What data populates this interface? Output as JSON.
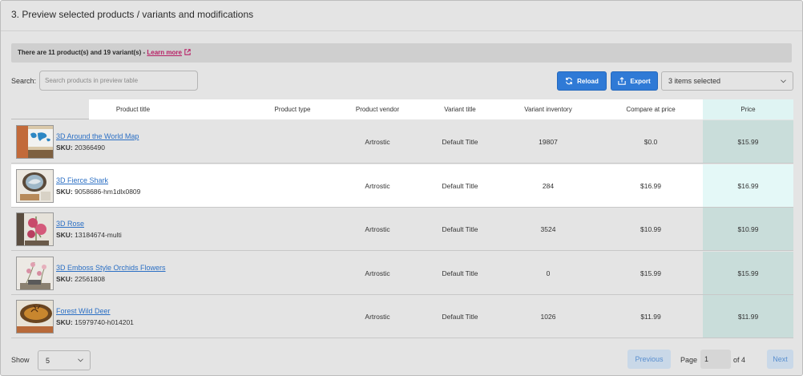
{
  "section_title": "3. Preview selected products / variants and modifications",
  "notice": {
    "text": "There are 11 product(s) and 19 variant(s) - ",
    "link": "Learn more"
  },
  "search": {
    "label": "Search:",
    "placeholder": "Search products in preview table"
  },
  "toolbar": {
    "reload_label": "Reload",
    "export_label": "Export",
    "selected_label": "3 items selected"
  },
  "table": {
    "headers": [
      "Product title",
      "Product type",
      "Product vendor",
      "Variant title",
      "Variant inventory",
      "Compare at price",
      "Price"
    ],
    "rows": [
      {
        "title": "3D Around the World Map",
        "sku_label": "SKU:",
        "sku": "20366490",
        "type": "",
        "vendor": "Artrostic",
        "variant": "Default Title",
        "inventory": "19807",
        "compare": "$0.0",
        "price": "$15.99",
        "thumb": "world-map"
      },
      {
        "title": "3D Fierce Shark",
        "sku_label": "SKU:",
        "sku": "9058686-hm1dlx0809",
        "type": "",
        "vendor": "Artrostic",
        "variant": "Default Title",
        "inventory": "284",
        "compare": "$16.99",
        "price": "$16.99",
        "thumb": "shark"
      },
      {
        "title": "3D Rose",
        "sku_label": "SKU:",
        "sku": "13184674-multi",
        "type": "",
        "vendor": "Artrostic",
        "variant": "Default Title",
        "inventory": "3524",
        "compare": "$10.99",
        "price": "$10.99",
        "thumb": "rose"
      },
      {
        "title": "3D Emboss Style Orchids Flowers",
        "sku_label": "SKU:",
        "sku": "22561808",
        "type": "",
        "vendor": "Artrostic",
        "variant": "Default Title",
        "inventory": "0",
        "compare": "$15.99",
        "price": "$15.99",
        "thumb": "orchids"
      },
      {
        "title": "Forest Wild Deer",
        "sku_label": "SKU:",
        "sku": "15979740-h014201",
        "type": "",
        "vendor": "Artrostic",
        "variant": "Default Title",
        "inventory": "1026",
        "compare": "$11.99",
        "price": "$11.99",
        "thumb": "deer"
      }
    ]
  },
  "footer": {
    "show_label": "Show",
    "page_size": "5",
    "prev_label": "Previous",
    "page_label": "Page",
    "page_value": "1",
    "of_label": "of 4",
    "next_label": "Next"
  },
  "colors": {
    "accent": "#2f7ad6",
    "link": "#2b6fc4",
    "learn_more": "#b81f65",
    "price_column": "#c9ddda"
  }
}
